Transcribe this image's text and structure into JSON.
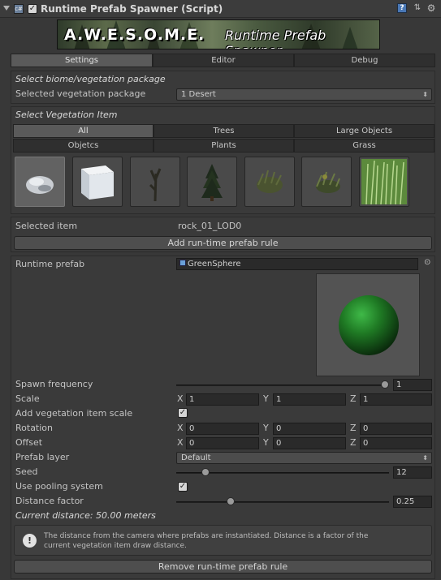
{
  "header": {
    "title": "Runtime Prefab Spawner (Script)",
    "help_icon": "?",
    "preset_icon": "⇅",
    "gear_icon": "⚙",
    "script_icon": "c#",
    "check": "✓",
    "fold_icon": "triangle-down"
  },
  "banner": {
    "brand": "A.W.E.S.O.M.E.",
    "product": "Runtime Prefab Spawner"
  },
  "main_tabs": [
    "Settings",
    "Editor",
    "Debug"
  ],
  "biome": {
    "heading": "Select biome/vegetation package",
    "label": "Selected vegetation package",
    "value": "1 Desert",
    "arrow": "⬍"
  },
  "veg_item": {
    "heading": "Select Vegetation Item",
    "filters_row1": [
      "All",
      "Trees",
      "Large Objects"
    ],
    "filters_row2": [
      "Objetcs",
      "Plants",
      "Grass"
    ],
    "thumbnails": [
      "rock",
      "cube",
      "dead-tree",
      "pine-tree",
      "bush",
      "shrub",
      "grass"
    ]
  },
  "selection": {
    "label": "Selected item",
    "value": "rock_01_LOD0",
    "add_button": "Add run-time prefab rule"
  },
  "rule": {
    "prefab_label": "Runtime prefab",
    "prefab_value": "GreenSphere",
    "prefab_picker": "⊙",
    "spawn_frequency_label": "Spawn frequency",
    "spawn_frequency_value": "1",
    "scale_label": "Scale",
    "scale": {
      "x": "1",
      "y": "1",
      "z": "1"
    },
    "add_scale_label": "Add vegetation item scale",
    "add_scale_check": "✓",
    "rotation_label": "Rotation",
    "rotation": {
      "x": "0",
      "y": "0",
      "z": "0"
    },
    "offset_label": "Offset",
    "offset": {
      "x": "0",
      "y": "0",
      "z": "0"
    },
    "layer_label": "Prefab layer",
    "layer_value": "Default",
    "seed_label": "Seed",
    "seed_value": "12",
    "pooling_label": "Use pooling system",
    "pooling_check": "✓",
    "distance_label": "Distance factor",
    "distance_value": "0.25",
    "current_distance": "Current distance: 50.00 meters",
    "info_icon": "!",
    "info_text_1": "The distance from the camera where prefabs are instantiated. Distance is a factor of the",
    "info_text_2": "current vegetation item draw distance.",
    "remove_button": "Remove run-time prefab rule",
    "axis": {
      "x": "X",
      "y": "Y",
      "z": "Z"
    }
  },
  "colors": {
    "background": "#383838",
    "sphere": "#1f7a24",
    "selected_tab": "#5a5a5a"
  },
  "sliders": {
    "spawn_frequency": 1.0,
    "seed": 0.13,
    "distance_factor": 0.25
  }
}
